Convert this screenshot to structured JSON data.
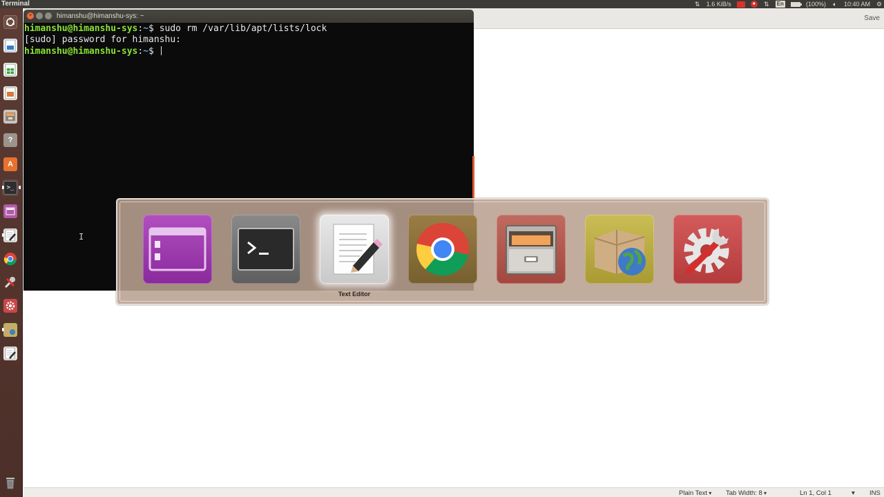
{
  "top_panel": {
    "app_name": "Terminal",
    "network_speed": "1.6 KiB/s",
    "keyboard_layout": "En",
    "battery_text": "(100%)",
    "battery_level_pct": 100,
    "clock": "10:40 AM"
  },
  "launcher": {
    "items": [
      {
        "name": "dash-home-icon"
      },
      {
        "name": "libreoffice-writer-icon"
      },
      {
        "name": "libreoffice-calc-icon"
      },
      {
        "name": "libreoffice-impress-icon"
      },
      {
        "name": "files-icon"
      },
      {
        "name": "help-icon"
      },
      {
        "name": "software-center-icon"
      },
      {
        "name": "terminal-icon"
      },
      {
        "name": "workspace-icon"
      },
      {
        "name": "text-editor-icon"
      },
      {
        "name": "chrome-icon"
      },
      {
        "name": "system-settings-icon"
      },
      {
        "name": "update-manager-icon"
      },
      {
        "name": "archive-manager-icon"
      },
      {
        "name": "text-editor-2-icon"
      },
      {
        "name": "trash-icon"
      }
    ]
  },
  "terminal": {
    "title": "himanshu@himanshu-sys: ~",
    "close_glyph": "×",
    "lines": [
      {
        "user": "himanshu@himanshu-sys",
        "sep": ":",
        "path": "~",
        "dollar": "$ ",
        "cmd": "sudo rm /var/lib/apt/lists/lock"
      },
      {
        "plain": "[sudo] password for himanshu:"
      },
      {
        "user": "himanshu@himanshu-sys",
        "sep": ":",
        "path": "~",
        "dollar": "$ ",
        "cmd": ""
      }
    ],
    "ibeam": "I"
  },
  "gedit": {
    "save_label": "Save",
    "status": {
      "syntax": "Plain Text",
      "tab_width": "Tab Width: 8",
      "position": "Ln 1, Col 1",
      "mode": "INS"
    }
  },
  "switcher": {
    "selected_label": "Text Editor",
    "apps": [
      {
        "name": "workspace",
        "color": "#a030b0"
      },
      {
        "name": "terminal",
        "color": "#6d6d6d"
      },
      {
        "name": "text-editor",
        "color": "#d8d8d8"
      },
      {
        "name": "chrome",
        "color": "#8a6e3c"
      },
      {
        "name": "files",
        "color": "#b3574f"
      },
      {
        "name": "archive-manager",
        "color": "#b9a93e"
      },
      {
        "name": "system-settings",
        "color": "#c64a4a"
      }
    ]
  },
  "colors": {
    "panel_bg": "#3c3b37",
    "launcher_bg": "#5a3d33",
    "terminal_bg": "#0b0b0b",
    "prompt_user": "#8ae234",
    "prompt_path": "#729fcf",
    "accent_orange": "#e05a2c"
  }
}
